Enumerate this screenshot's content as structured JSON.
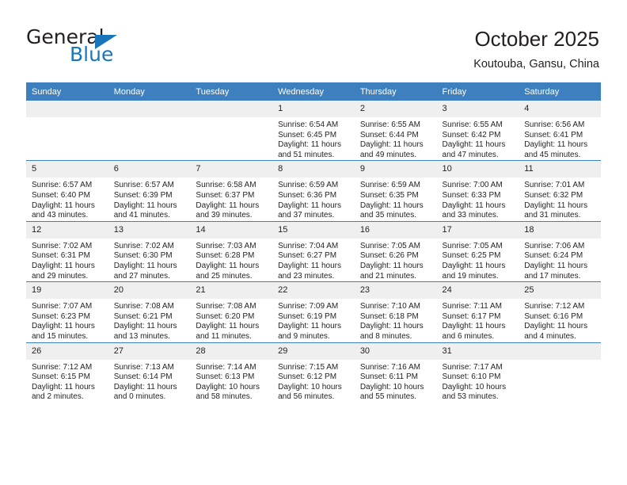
{
  "brand": {
    "name_part1": "General",
    "name_part2": "Blue",
    "primary_color": "#1b75bb",
    "header_color": "#3d7fbf",
    "logo_icon": "triangle-icon"
  },
  "header": {
    "title": "October 2025",
    "subtitle": "Koutouba, Gansu, China"
  },
  "calendar": {
    "weekday_headers": [
      "Sunday",
      "Monday",
      "Tuesday",
      "Wednesday",
      "Thursday",
      "Friday",
      "Saturday"
    ],
    "weeks": [
      [
        {
          "day": "",
          "empty": true
        },
        {
          "day": "",
          "empty": true
        },
        {
          "day": "",
          "empty": true
        },
        {
          "day": "1",
          "sunrise": "Sunrise: 6:54 AM",
          "sunset": "Sunset: 6:45 PM",
          "daylight": "Daylight: 11 hours and 51 minutes."
        },
        {
          "day": "2",
          "sunrise": "Sunrise: 6:55 AM",
          "sunset": "Sunset: 6:44 PM",
          "daylight": "Daylight: 11 hours and 49 minutes."
        },
        {
          "day": "3",
          "sunrise": "Sunrise: 6:55 AM",
          "sunset": "Sunset: 6:42 PM",
          "daylight": "Daylight: 11 hours and 47 minutes."
        },
        {
          "day": "4",
          "sunrise": "Sunrise: 6:56 AM",
          "sunset": "Sunset: 6:41 PM",
          "daylight": "Daylight: 11 hours and 45 minutes."
        }
      ],
      [
        {
          "day": "5",
          "sunrise": "Sunrise: 6:57 AM",
          "sunset": "Sunset: 6:40 PM",
          "daylight": "Daylight: 11 hours and 43 minutes."
        },
        {
          "day": "6",
          "sunrise": "Sunrise: 6:57 AM",
          "sunset": "Sunset: 6:39 PM",
          "daylight": "Daylight: 11 hours and 41 minutes."
        },
        {
          "day": "7",
          "sunrise": "Sunrise: 6:58 AM",
          "sunset": "Sunset: 6:37 PM",
          "daylight": "Daylight: 11 hours and 39 minutes."
        },
        {
          "day": "8",
          "sunrise": "Sunrise: 6:59 AM",
          "sunset": "Sunset: 6:36 PM",
          "daylight": "Daylight: 11 hours and 37 minutes."
        },
        {
          "day": "9",
          "sunrise": "Sunrise: 6:59 AM",
          "sunset": "Sunset: 6:35 PM",
          "daylight": "Daylight: 11 hours and 35 minutes."
        },
        {
          "day": "10",
          "sunrise": "Sunrise: 7:00 AM",
          "sunset": "Sunset: 6:33 PM",
          "daylight": "Daylight: 11 hours and 33 minutes."
        },
        {
          "day": "11",
          "sunrise": "Sunrise: 7:01 AM",
          "sunset": "Sunset: 6:32 PM",
          "daylight": "Daylight: 11 hours and 31 minutes."
        }
      ],
      [
        {
          "day": "12",
          "sunrise": "Sunrise: 7:02 AM",
          "sunset": "Sunset: 6:31 PM",
          "daylight": "Daylight: 11 hours and 29 minutes."
        },
        {
          "day": "13",
          "sunrise": "Sunrise: 7:02 AM",
          "sunset": "Sunset: 6:30 PM",
          "daylight": "Daylight: 11 hours and 27 minutes."
        },
        {
          "day": "14",
          "sunrise": "Sunrise: 7:03 AM",
          "sunset": "Sunset: 6:28 PM",
          "daylight": "Daylight: 11 hours and 25 minutes."
        },
        {
          "day": "15",
          "sunrise": "Sunrise: 7:04 AM",
          "sunset": "Sunset: 6:27 PM",
          "daylight": "Daylight: 11 hours and 23 minutes."
        },
        {
          "day": "16",
          "sunrise": "Sunrise: 7:05 AM",
          "sunset": "Sunset: 6:26 PM",
          "daylight": "Daylight: 11 hours and 21 minutes."
        },
        {
          "day": "17",
          "sunrise": "Sunrise: 7:05 AM",
          "sunset": "Sunset: 6:25 PM",
          "daylight": "Daylight: 11 hours and 19 minutes."
        },
        {
          "day": "18",
          "sunrise": "Sunrise: 7:06 AM",
          "sunset": "Sunset: 6:24 PM",
          "daylight": "Daylight: 11 hours and 17 minutes."
        }
      ],
      [
        {
          "day": "19",
          "sunrise": "Sunrise: 7:07 AM",
          "sunset": "Sunset: 6:23 PM",
          "daylight": "Daylight: 11 hours and 15 minutes."
        },
        {
          "day": "20",
          "sunrise": "Sunrise: 7:08 AM",
          "sunset": "Sunset: 6:21 PM",
          "daylight": "Daylight: 11 hours and 13 minutes."
        },
        {
          "day": "21",
          "sunrise": "Sunrise: 7:08 AM",
          "sunset": "Sunset: 6:20 PM",
          "daylight": "Daylight: 11 hours and 11 minutes."
        },
        {
          "day": "22",
          "sunrise": "Sunrise: 7:09 AM",
          "sunset": "Sunset: 6:19 PM",
          "daylight": "Daylight: 11 hours and 9 minutes."
        },
        {
          "day": "23",
          "sunrise": "Sunrise: 7:10 AM",
          "sunset": "Sunset: 6:18 PM",
          "daylight": "Daylight: 11 hours and 8 minutes."
        },
        {
          "day": "24",
          "sunrise": "Sunrise: 7:11 AM",
          "sunset": "Sunset: 6:17 PM",
          "daylight": "Daylight: 11 hours and 6 minutes."
        },
        {
          "day": "25",
          "sunrise": "Sunrise: 7:12 AM",
          "sunset": "Sunset: 6:16 PM",
          "daylight": "Daylight: 11 hours and 4 minutes."
        }
      ],
      [
        {
          "day": "26",
          "sunrise": "Sunrise: 7:12 AM",
          "sunset": "Sunset: 6:15 PM",
          "daylight": "Daylight: 11 hours and 2 minutes."
        },
        {
          "day": "27",
          "sunrise": "Sunrise: 7:13 AM",
          "sunset": "Sunset: 6:14 PM",
          "daylight": "Daylight: 11 hours and 0 minutes."
        },
        {
          "day": "28",
          "sunrise": "Sunrise: 7:14 AM",
          "sunset": "Sunset: 6:13 PM",
          "daylight": "Daylight: 10 hours and 58 minutes."
        },
        {
          "day": "29",
          "sunrise": "Sunrise: 7:15 AM",
          "sunset": "Sunset: 6:12 PM",
          "daylight": "Daylight: 10 hours and 56 minutes."
        },
        {
          "day": "30",
          "sunrise": "Sunrise: 7:16 AM",
          "sunset": "Sunset: 6:11 PM",
          "daylight": "Daylight: 10 hours and 55 minutes."
        },
        {
          "day": "31",
          "sunrise": "Sunrise: 7:17 AM",
          "sunset": "Sunset: 6:10 PM",
          "daylight": "Daylight: 10 hours and 53 minutes."
        },
        {
          "day": "",
          "empty": true
        }
      ]
    ]
  }
}
